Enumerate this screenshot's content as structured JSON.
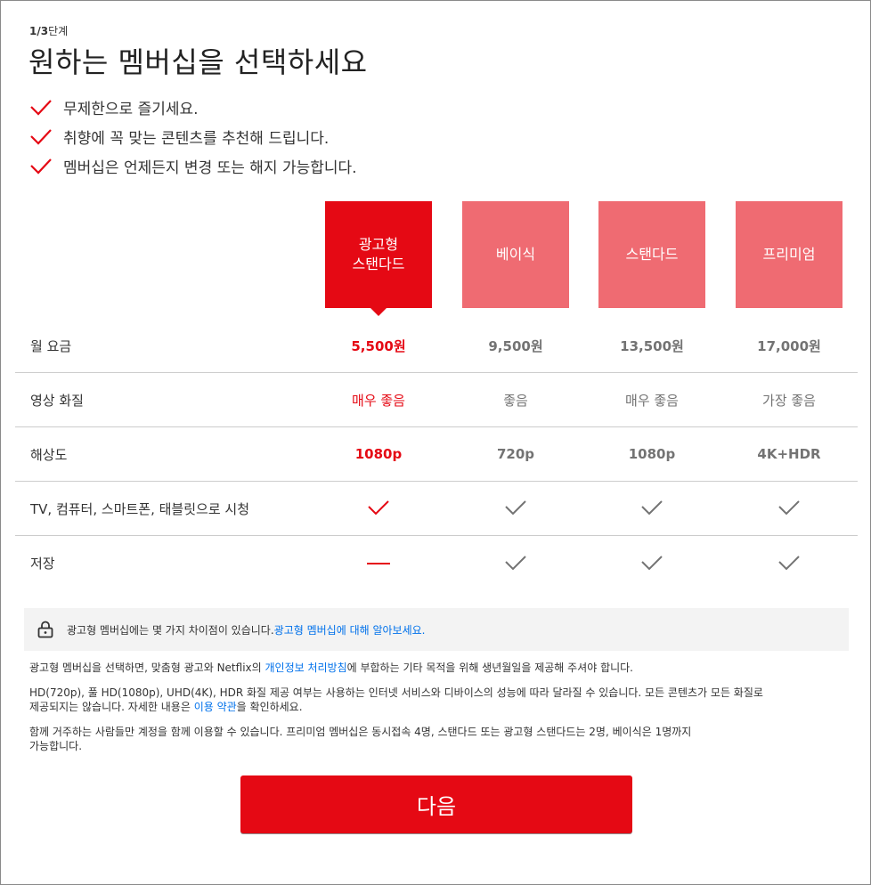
{
  "header": {
    "step_prefix": "1/3",
    "step_suffix": "단계",
    "title": "원하는 멤버십을 선택하세요"
  },
  "benefits": [
    "무제한으로 즐기세요.",
    "취향에 꼭 맞는 콘텐츠를 추천해 드립니다.",
    "멤버십은 언제든지 변경 또는 해지 가능합니다."
  ],
  "plans": [
    {
      "name": "광고형\n스탠다드",
      "selected": true
    },
    {
      "name": "베이식",
      "selected": false
    },
    {
      "name": "스탠다드",
      "selected": false
    },
    {
      "name": "프리미엄",
      "selected": false
    }
  ],
  "rows": {
    "price": {
      "label": "월 요금",
      "values": [
        "5,500원",
        "9,500원",
        "13,500원",
        "17,000원"
      ]
    },
    "quality": {
      "label": "영상 화질",
      "values": [
        "매우 좋음",
        "좋음",
        "매우 좋음",
        "가장 좋음"
      ]
    },
    "resolution": {
      "label": "해상도",
      "values": [
        "1080p",
        "720p",
        "1080p",
        "4K+HDR"
      ]
    },
    "devices": {
      "label": "TV, 컴퓨터, 스마트폰, 태블릿으로 시청",
      "values": [
        "check-icon",
        "check-icon",
        "check-icon",
        "check-icon"
      ]
    },
    "download": {
      "label": "저장",
      "values": [
        "dash-icon",
        "check-icon",
        "check-icon",
        "check-icon"
      ]
    }
  },
  "notice": {
    "icon": "lock-icon",
    "text": "광고형 멤버십에는 몇 가지 차이점이 있습니다. ",
    "link": "광고형 멤버십에 대해 알아보세요."
  },
  "fine_print": {
    "p1_before": "광고형 멤버십을 선택하면, 맞춤형 광고와 Netflix의 ",
    "p1_link": "개인정보 처리방침",
    "p1_after": "에 부합하는 기타 목적을 위해 생년월일을 제공해 주셔야 합니다.",
    "p2_line1": "HD(720p), 풀 HD(1080p), UHD(4K), HDR 화질 제공 여부는 사용하는 인터넷 서비스와 디바이스의 성능에 따라 달라질 수 있습니다. 모든 콘텐츠가 모든 화질로",
    "p2_line2_before": "제공되지는 않습니다. 자세한 내용은 ",
    "p2_link": "이용 약관",
    "p2_after": "을 확인하세요.",
    "p3_line1": "함께 거주하는 사람들만 계정을 함께 이용할 수 있습니다. 프리미엄 멤버십은 동시접속 4명, 스탠다드 또는 광고형 스탠다드는 2명, 베이식은 1명까지",
    "p3_line2": "가능합니다."
  },
  "next_button": {
    "label": "다음"
  },
  "colors": {
    "accent": "#e50914",
    "plan_unselected": "#ef6b72",
    "link": "#0071eb",
    "check_gray": "#737373"
  }
}
